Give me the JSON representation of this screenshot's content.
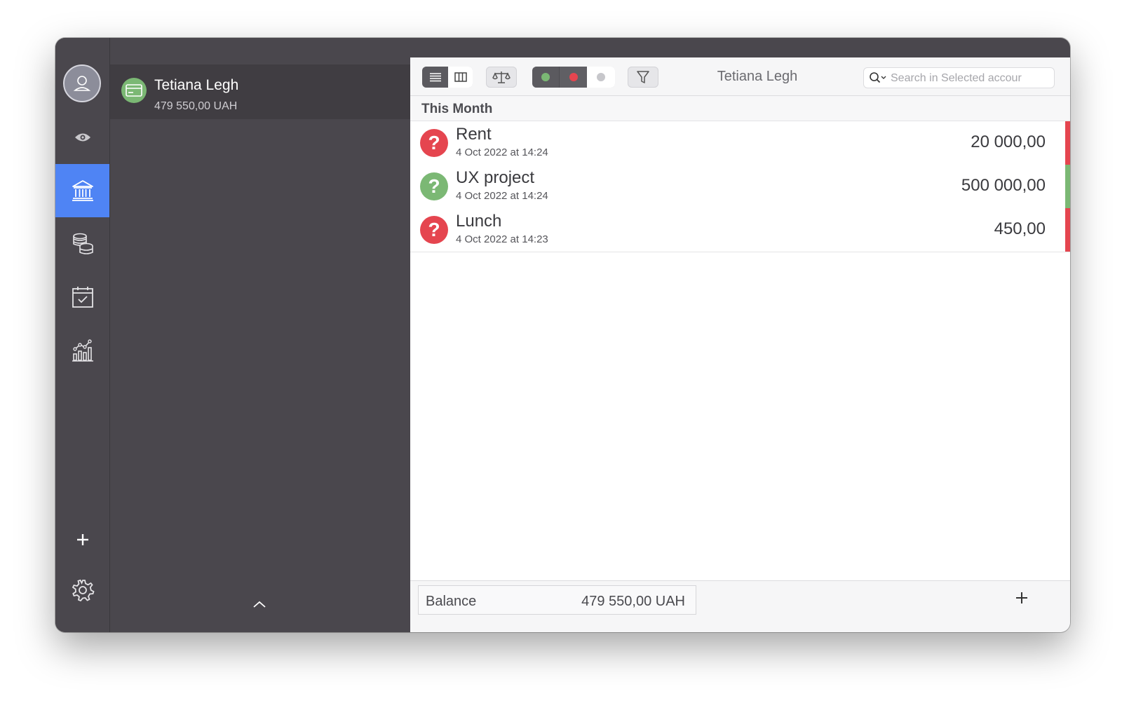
{
  "window": {
    "title": "Tetiana Legh"
  },
  "sidebar": {
    "items": [
      {
        "name": "overview",
        "icon": "eye-icon"
      },
      {
        "name": "accounts",
        "icon": "bank-icon",
        "active": true
      },
      {
        "name": "budgets",
        "icon": "coins-icon"
      },
      {
        "name": "scheduled",
        "icon": "calendar-check-icon"
      },
      {
        "name": "reports",
        "icon": "chart-icon"
      }
    ],
    "add_icon": "plus-icon",
    "settings_icon": "gear-icon"
  },
  "account": {
    "name": "Tetiana Legh",
    "balance": "479 550,00 UAH",
    "icon": "credit-card-icon",
    "icon_color": "#7bb874"
  },
  "toolbar": {
    "title": "Tetiana Legh",
    "search_placeholder": "Search in Selected accour",
    "view_icons": [
      "list-icon",
      "columns-icon"
    ],
    "balance_icon": "scales-icon",
    "status_colors": [
      "#7bb874",
      "#e5454f",
      "#c7c7cb"
    ],
    "filter_icon": "filter-icon"
  },
  "section": {
    "title": "This Month"
  },
  "transactions": [
    {
      "title": "Rent",
      "date": "4 Oct 2022 at 14:24",
      "amount": "20 000,00",
      "icon_color": "#e5454f",
      "bar_color": "#e5454f"
    },
    {
      "title": "UX project",
      "date": "4 Oct 2022 at 14:24",
      "amount": "500 000,00",
      "icon_color": "#7bb874",
      "bar_color": "#7bb874"
    },
    {
      "title": "Lunch",
      "date": "4 Oct 2022 at 14:23",
      "amount": "450,00",
      "icon_color": "#e5454f",
      "bar_color": "#e5454f"
    }
  ],
  "transaction_icon_glyph": "?",
  "footer": {
    "balance_label": "Balance",
    "balance_value": "479 550,00 UAH"
  },
  "colors": {
    "accent": "#4f84f4",
    "sidebar_bg": "#4a474d",
    "expense": "#e5454f",
    "income": "#7bb874"
  }
}
